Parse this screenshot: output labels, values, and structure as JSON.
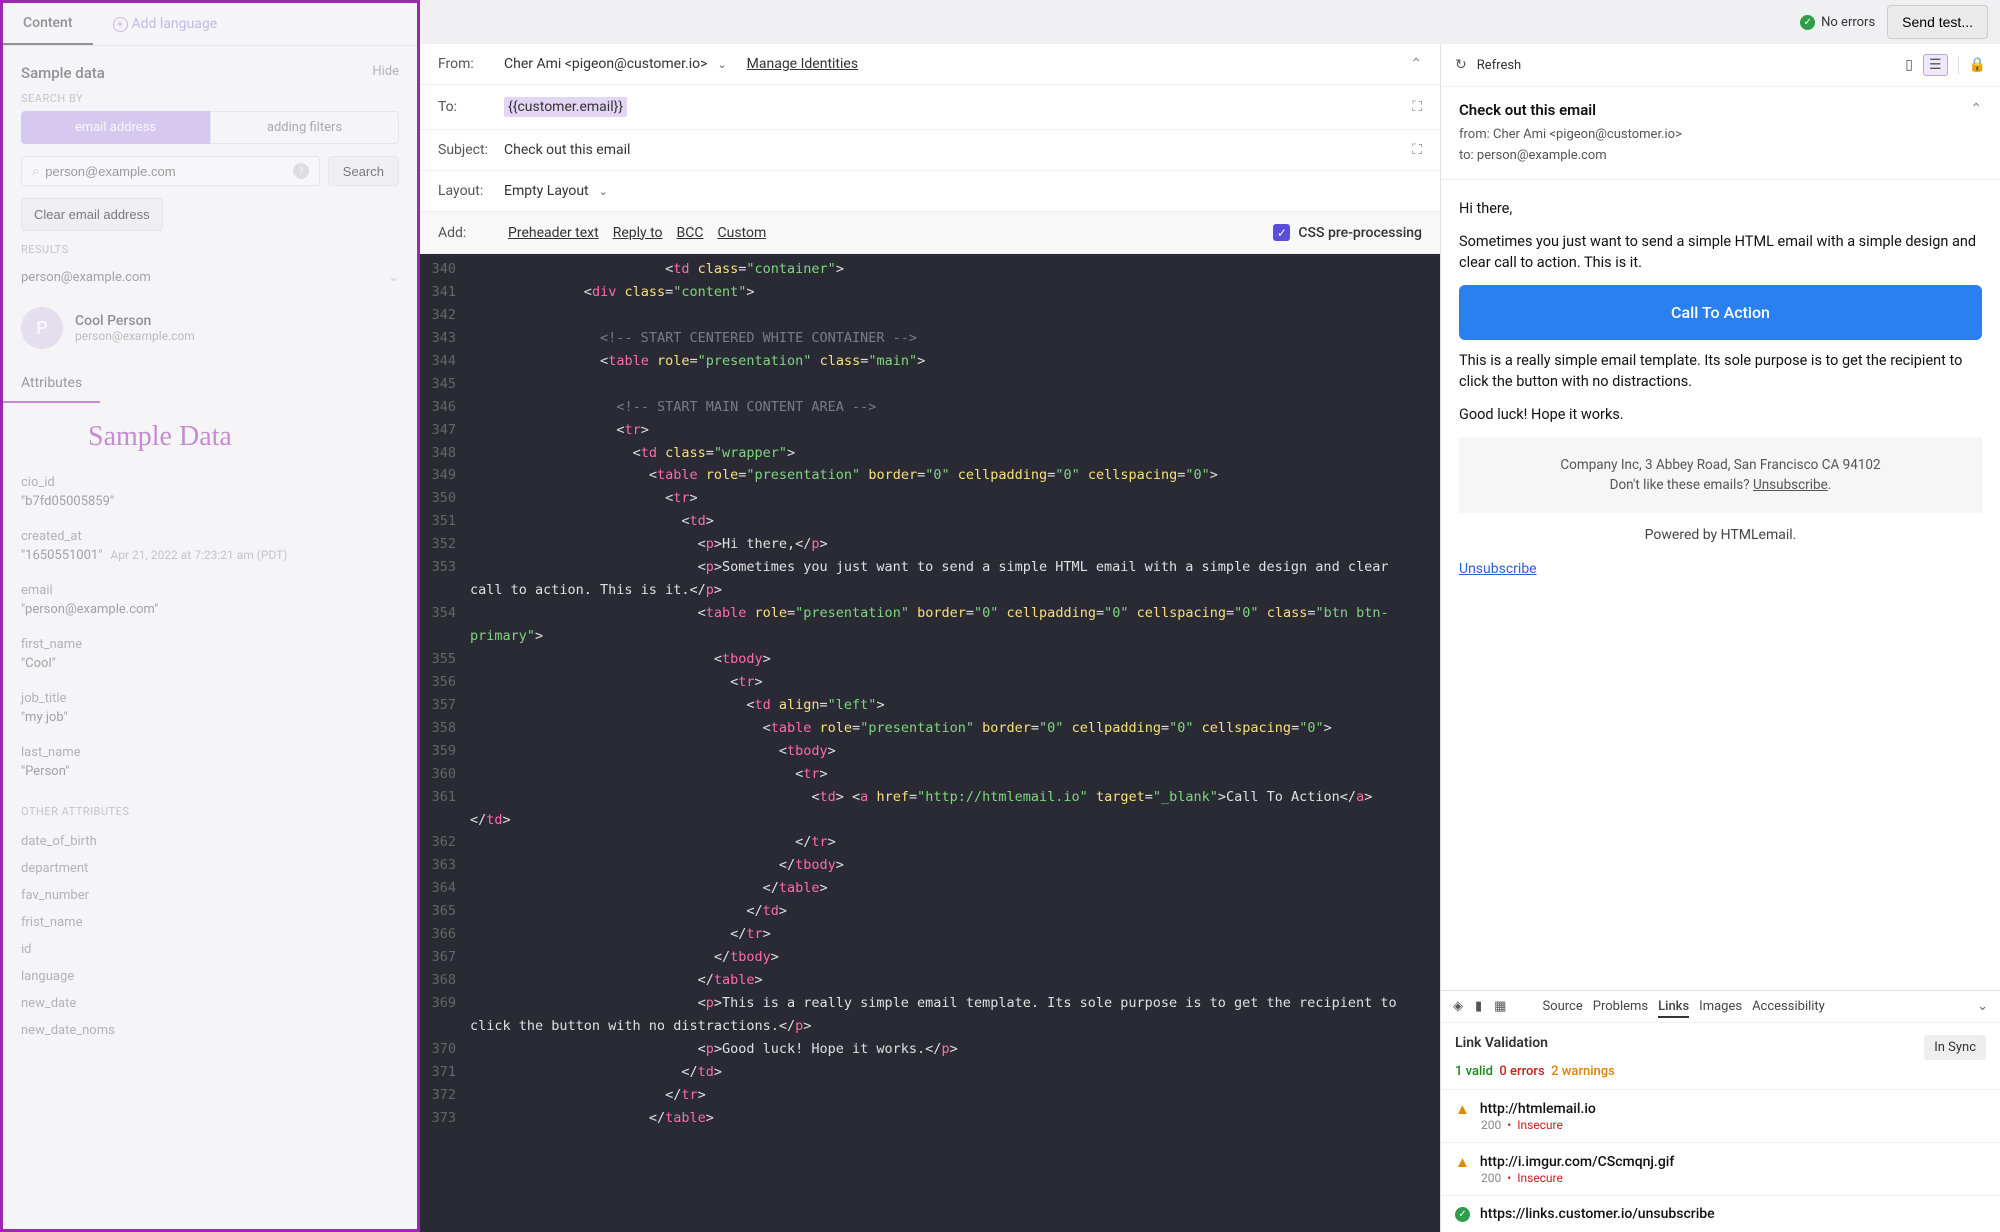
{
  "left": {
    "tabs": {
      "content": "Content",
      "add_language": "Add language"
    },
    "sample_data_label": "Sample data",
    "hide": "Hide",
    "search_by": "SEARCH BY",
    "pills": {
      "email": "email address",
      "filters": "adding filters"
    },
    "search_placeholder": "person@example.com",
    "search_button": "Search",
    "clear_button": "Clear email address",
    "results_label": "RESULTS",
    "result_email": "person@example.com",
    "person": {
      "initial": "P",
      "name": "Cool Person",
      "email": "person@example.com"
    },
    "attributes_tab": "Attributes",
    "title_annotation": "Sample Data",
    "attrs": [
      {
        "k": "cio_id",
        "v": "\"b7fd05005859\""
      },
      {
        "k": "created_at",
        "v": "\"1650551001\"",
        "date": "Apr 21, 2022 at 7:23:21 am (PDT)"
      },
      {
        "k": "email",
        "v": "\"person@example.com\""
      },
      {
        "k": "first_name",
        "v": "\"Cool\""
      },
      {
        "k": "job_title",
        "v": "\"my job\""
      },
      {
        "k": "last_name",
        "v": "\"Person\""
      }
    ],
    "other_attrs_label": "OTHER ATTRIBUTES",
    "other_attrs": [
      "date_of_birth",
      "department",
      "fav_number",
      "frist_name",
      "id",
      "language",
      "new_date",
      "new_date_noms"
    ]
  },
  "topbar": {
    "no_errors": "No errors",
    "send_test": "Send test..."
  },
  "headers": {
    "from_label": "From:",
    "from_value": "Cher Ami <pigeon@customer.io>",
    "manage": "Manage Identities",
    "to_label": "To:",
    "to_value": "{{customer.email}}",
    "subject_label": "Subject:",
    "subject_value": "Check out this email",
    "layout_label": "Layout:",
    "layout_value": "Empty Layout",
    "add_label": "Add:",
    "preheader": "Preheader text",
    "reply_to": "Reply to",
    "bcc": "BCC",
    "custom": "Custom",
    "css_pre": "CSS pre-processing"
  },
  "code": [
    {
      "n": 340,
      "h": "                        &lt;<span class='t-tag'>td</span> <span class='t-attr'>class</span>=<span class='t-str'>\"container\"</span>&gt;"
    },
    {
      "n": 341,
      "h": "              &lt;<span class='t-tag'>div</span> <span class='t-attr'>class</span>=<span class='t-str'>\"content\"</span>&gt;"
    },
    {
      "n": 342,
      "h": ""
    },
    {
      "n": 343,
      "h": "                <span class='t-cmt'>&lt;!-- START CENTERED WHITE CONTAINER --&gt;</span>"
    },
    {
      "n": 344,
      "h": "                &lt;<span class='t-tag'>table</span> <span class='t-attr'>role</span>=<span class='t-str'>\"presentation\"</span> <span class='t-attr'>class</span>=<span class='t-str'>\"main\"</span>&gt;"
    },
    {
      "n": 345,
      "h": ""
    },
    {
      "n": 346,
      "h": "                  <span class='t-cmt'>&lt;!-- START MAIN CONTENT AREA --&gt;</span>"
    },
    {
      "n": 347,
      "h": "                  &lt;<span class='t-tag'>tr</span>&gt;"
    },
    {
      "n": 348,
      "h": "                    &lt;<span class='t-tag'>td</span> <span class='t-attr'>class</span>=<span class='t-str'>\"wrapper\"</span>&gt;"
    },
    {
      "n": 349,
      "h": "                      &lt;<span class='t-tag'>table</span> <span class='t-attr'>role</span>=<span class='t-str'>\"presentation\"</span> <span class='t-attr'>border</span>=<span class='t-str'>\"0\"</span> <span class='t-attr'>cellpadding</span>=<span class='t-str'>\"0\"</span> <span class='t-attr'>cellspacing</span>=<span class='t-str'>\"0\"</span>&gt;"
    },
    {
      "n": 350,
      "h": "                        &lt;<span class='t-tag'>tr</span>&gt;"
    },
    {
      "n": 351,
      "h": "                          &lt;<span class='t-tag'>td</span>&gt;"
    },
    {
      "n": 352,
      "h": "                            &lt;<span class='t-tag'>p</span>&gt;Hi there,&lt;/<span class='t-tag'>p</span>&gt;"
    },
    {
      "n": 353,
      "h": "                            &lt;<span class='t-tag'>p</span>&gt;Sometimes you just want to send a simple HTML email with a simple design and clear call to action. This is it.&lt;/<span class='t-tag'>p</span>&gt;"
    },
    {
      "n": 354,
      "h": "                            &lt;<span class='t-tag'>table</span> <span class='t-attr'>role</span>=<span class='t-str'>\"presentation\"</span> <span class='t-attr'>border</span>=<span class='t-str'>\"0\"</span> <span class='t-attr'>cellpadding</span>=<span class='t-str'>\"0\"</span> <span class='t-attr'>cellspacing</span>=<span class='t-str'>\"0\"</span> <span class='t-attr'>class</span>=<span class='t-str'>\"btn btn-primary\"</span>&gt;"
    },
    {
      "n": 355,
      "h": "                              &lt;<span class='t-tag'>tbody</span>&gt;"
    },
    {
      "n": 356,
      "h": "                                &lt;<span class='t-tag'>tr</span>&gt;"
    },
    {
      "n": 357,
      "h": "                                  &lt;<span class='t-tag'>td</span> <span class='t-attr'>align</span>=<span class='t-str'>\"left\"</span>&gt;"
    },
    {
      "n": 358,
      "h": "                                    &lt;<span class='t-tag'>table</span> <span class='t-attr'>role</span>=<span class='t-str'>\"presentation\"</span> <span class='t-attr'>border</span>=<span class='t-str'>\"0\"</span> <span class='t-attr'>cellpadding</span>=<span class='t-str'>\"0\"</span> <span class='t-attr'>cellspacing</span>=<span class='t-str'>\"0\"</span>&gt;"
    },
    {
      "n": 359,
      "h": "                                      &lt;<span class='t-tag'>tbody</span>&gt;"
    },
    {
      "n": 360,
      "h": "                                        &lt;<span class='t-tag'>tr</span>&gt;"
    },
    {
      "n": 361,
      "h": "                                          &lt;<span class='t-tag'>td</span>&gt; &lt;<span class='t-tag'>a</span> <span class='t-attr'>href</span>=<span class='t-str'>\"http://htmlemail.io\"</span> <span class='t-attr'>target</span>=<span class='t-str'>\"_blank\"</span>&gt;Call To Action&lt;/<span class='t-tag'>a</span>&gt; &lt;/<span class='t-tag'>td</span>&gt;"
    },
    {
      "n": 362,
      "h": "                                        &lt;/<span class='t-tag'>tr</span>&gt;"
    },
    {
      "n": 363,
      "h": "                                      &lt;/<span class='t-tag'>tbody</span>&gt;"
    },
    {
      "n": 364,
      "h": "                                    &lt;/<span class='t-tag'>table</span>&gt;"
    },
    {
      "n": 365,
      "h": "                                  &lt;/<span class='t-tag'>td</span>&gt;"
    },
    {
      "n": 366,
      "h": "                                &lt;/<span class='t-tag'>tr</span>&gt;"
    },
    {
      "n": 367,
      "h": "                              &lt;/<span class='t-tag'>tbody</span>&gt;"
    },
    {
      "n": 368,
      "h": "                            &lt;/<span class='t-tag'>table</span>&gt;"
    },
    {
      "n": 369,
      "h": "                            &lt;<span class='t-tag'>p</span>&gt;This is a really simple email template. Its sole purpose is to get the recipient to click the button with no distractions.&lt;/<span class='t-tag'>p</span>&gt;"
    },
    {
      "n": 370,
      "h": "                            &lt;<span class='t-tag'>p</span>&gt;Good luck! Hope it works.&lt;/<span class='t-tag'>p</span>&gt;"
    },
    {
      "n": 371,
      "h": "                          &lt;/<span class='t-tag'>td</span>&gt;"
    },
    {
      "n": 372,
      "h": "                        &lt;/<span class='t-tag'>tr</span>&gt;"
    },
    {
      "n": 373,
      "h": "                      &lt;/<span class='t-tag'>table</span>&gt;"
    }
  ],
  "preview": {
    "refresh": "Refresh",
    "subject": "Check out this email",
    "from": "from: Cher Ami <pigeon@customer.io>",
    "to": "to: person@example.com",
    "hi": "Hi there,",
    "p1": "Sometimes you just want to send a simple HTML email with a simple design and clear call to action. This is it.",
    "cta": "Call To Action",
    "p2": "This is a really simple email template. Its sole purpose is to get the recipient to click the button with no distractions.",
    "p3": "Good luck! Hope it works.",
    "footer1": "Company Inc, 3 Abbey Road, San Francisco CA 94102",
    "footer2a": "Don't like these emails? ",
    "footer2b": "Unsubscribe",
    "footer2c": ".",
    "powered": "Powered by HTMLemail.",
    "unsubscribe": "Unsubscribe"
  },
  "inspector": {
    "tabs": [
      "Source",
      "Problems",
      "Links",
      "Images",
      "Accessibility"
    ],
    "active_tab": 2,
    "title": "Link Validation",
    "in_sync": "In Sync",
    "stats": {
      "valid": "1 valid",
      "errors": "0 errors",
      "warnings": "2 warnings"
    },
    "links": [
      {
        "status": "warn",
        "url": "http://htmlemail.io",
        "code": "200",
        "note": "Insecure"
      },
      {
        "status": "warn",
        "url": "http://i.imgur.com/CScmqnj.gif",
        "code": "200",
        "note": "Insecure"
      },
      {
        "status": "ok",
        "url": "https://links.customer.io/unsubscribe"
      }
    ]
  }
}
